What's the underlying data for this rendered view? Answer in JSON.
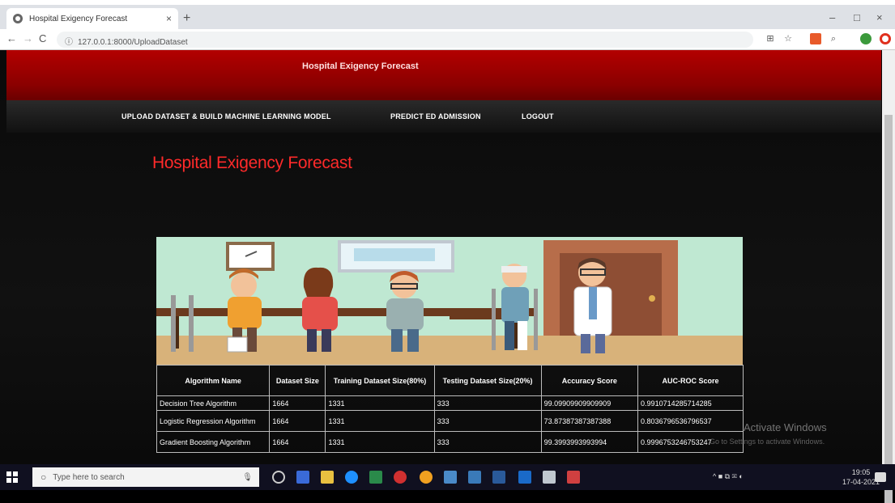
{
  "browser": {
    "tab_title": "Hospital Exigency Forecast",
    "tab_close": "×",
    "new_tab": "+",
    "url": "127.0.0.1:8000/UploadDataset",
    "nav_back": "←",
    "nav_forward": "→",
    "nav_reload": "C",
    "win_min": "–",
    "win_max": "□",
    "win_close": "×"
  },
  "site": {
    "header_title": "Hospital Exigency Forecast",
    "menu": [
      "UPLOAD DATASET & BUILD MACHINE LEARNING MODEL",
      "PREDICT ED ADMISSION",
      "LOGOUT"
    ],
    "page_title": "Hospital Exigency Forecast"
  },
  "table": {
    "headers": [
      "Algorithm Name",
      "Dataset Size",
      "Training Dataset Size(80%)",
      "Testing Dataset Size(20%)",
      "Accuracy Score",
      "AUC-ROC Score"
    ],
    "rows": [
      [
        "Decision Tree Algorithm",
        "1664",
        "1331",
        "333",
        "99.09909909909909",
        "0.9910714285714285"
      ],
      [
        "Logistic Regression Algorithm",
        "1664",
        "1331",
        "333",
        "73.87387387387388",
        "0.8036796536796537"
      ],
      [
        "Gradient Boosting Algorithm",
        "1664",
        "1331",
        "333",
        "99.3993993993994",
        "0.9996753246753247"
      ]
    ]
  },
  "watermark": {
    "line1": "Activate Windows",
    "line2": "Go to Settings to activate Windows."
  },
  "taskbar": {
    "search_placeholder": "Type here to search",
    "time": "19:05",
    "date": "17-04-2021"
  },
  "colors": {
    "header_red": "#8a0000",
    "title_red": "#ff2a2a",
    "page_bg": "#0a0a0a"
  }
}
